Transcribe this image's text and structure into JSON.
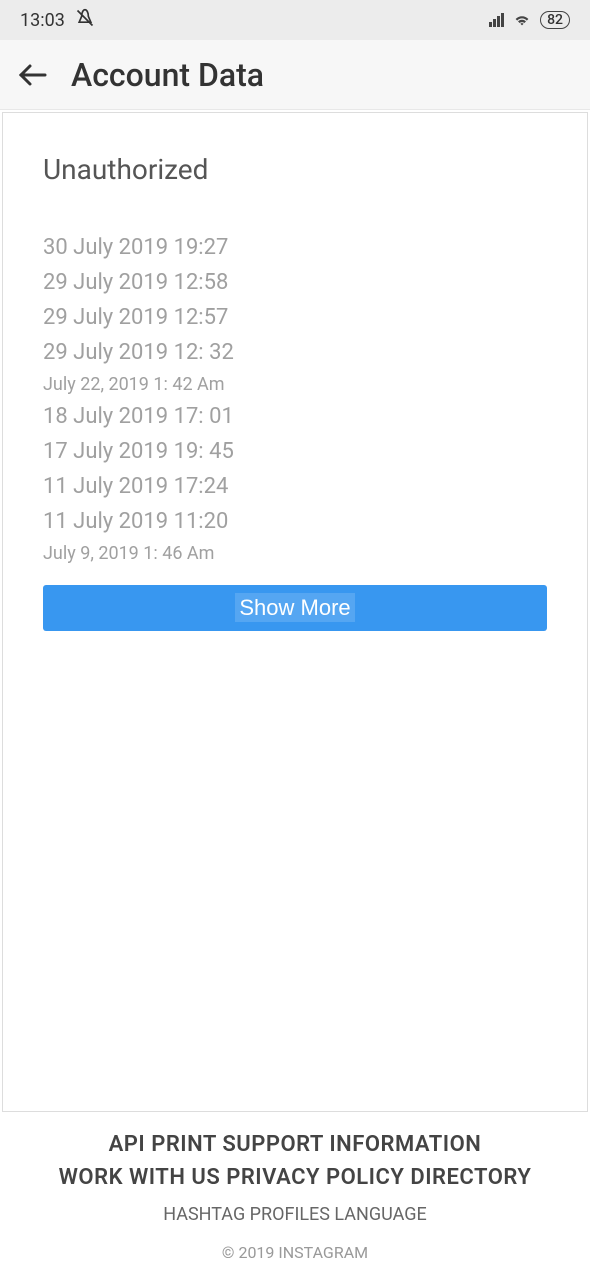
{
  "status_bar": {
    "time": "13:03",
    "battery": "82"
  },
  "header": {
    "title": "Account Data"
  },
  "section": {
    "title": "Unauthorized"
  },
  "entries": [
    {
      "text": "30 July 2019 19:27",
      "small": false
    },
    {
      "text": "29 July 2019 12:58",
      "small": false
    },
    {
      "text": "29 July 2019 12:57",
      "small": false
    },
    {
      "text": "29 July 2019 12: 32",
      "small": false
    },
    {
      "text": "July 22, 2019 1: 42 Am",
      "small": true
    },
    {
      "text": "18 July 2019 17: 01",
      "small": false
    },
    {
      "text": "17 July 2019 19: 45",
      "small": false
    },
    {
      "text": "11 July 2019 17:24",
      "small": false
    },
    {
      "text": "11 July 2019 11:20",
      "small": false
    },
    {
      "text": "July 9, 2019 1: 46 Am",
      "small": true
    }
  ],
  "buttons": {
    "show_more": "Show More"
  },
  "footer": {
    "line1": "API PRINT SUPPORT INFORMATION",
    "line2": "WORK WITH US PRIVACY POLICY DIRECTORY",
    "line3": "HASHTAG PROFILES LANGUAGE",
    "copyright": "© 2019 INSTAGRAM"
  }
}
